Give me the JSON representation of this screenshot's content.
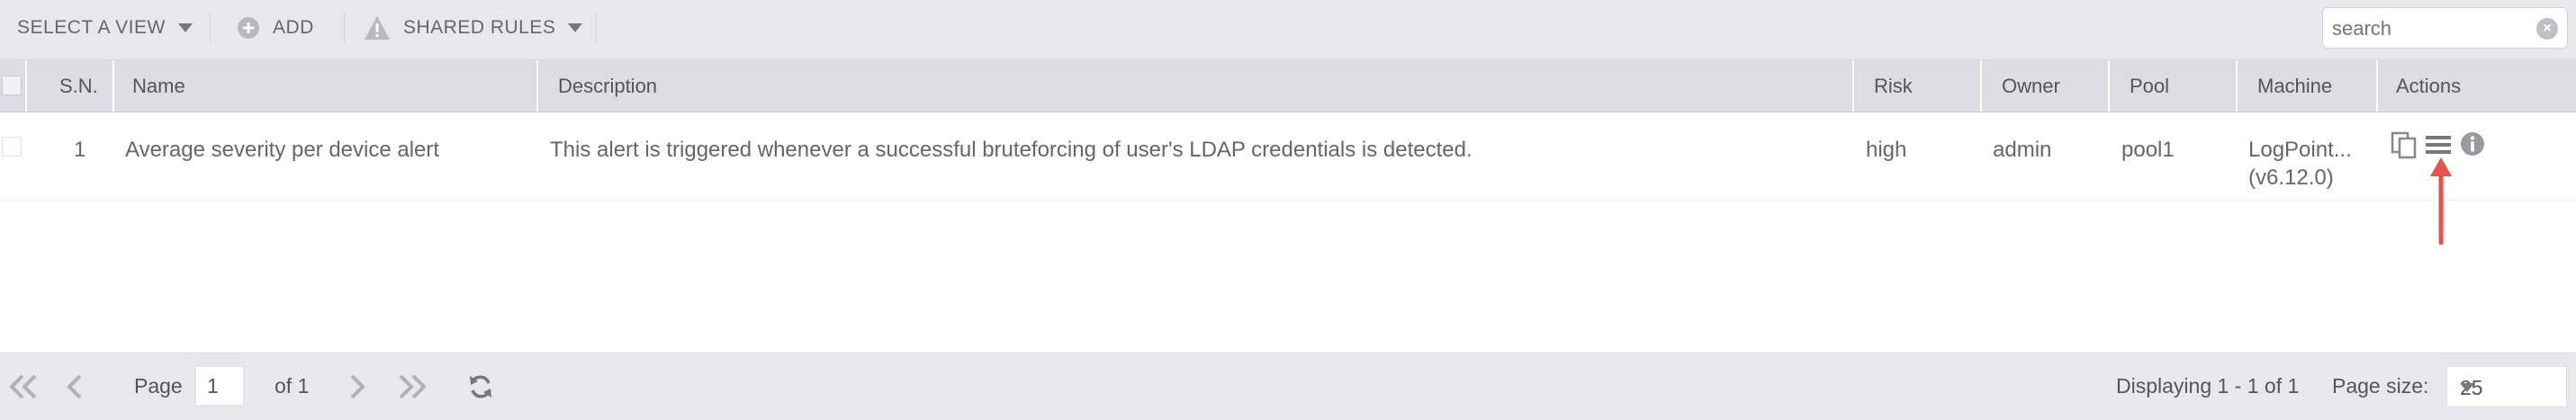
{
  "toolbar": {
    "select_view_label": "SELECT A VIEW",
    "add_label": "ADD",
    "shared_rules_label": "SHARED RULES",
    "search_placeholder": "search"
  },
  "table": {
    "columns": [
      "S.N.",
      "Name",
      "Description",
      "Risk",
      "Owner",
      "Pool",
      "Machine",
      "Actions"
    ],
    "rows": [
      {
        "sn": "1",
        "name": "Average severity per device alert",
        "description": "This alert is triggered whenever a successful bruteforcing of user's LDAP credentials is detected.",
        "risk": "high",
        "owner": "admin",
        "pool": "pool1",
        "machine_line1": "LogPoint...",
        "machine_line2": "(v6.12.0)"
      }
    ]
  },
  "pagination": {
    "page_label": "Page",
    "page_value": "1",
    "of_label": "of 1",
    "displaying": "Displaying 1 - 1 of 1",
    "page_size_label": "Page size:",
    "page_size_value": "25"
  },
  "colors": {
    "annotation_arrow": "#e8524a",
    "toolbar_bg": "#e8e8ec",
    "header_bg": "#dcdce2"
  }
}
